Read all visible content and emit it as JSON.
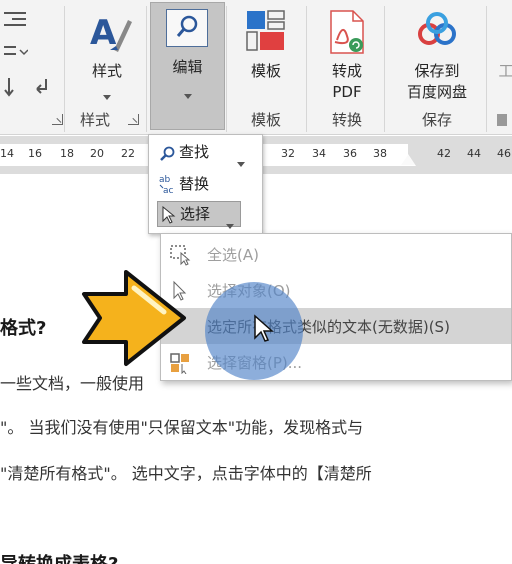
{
  "ribbon": {
    "buttons": {
      "style": "样式",
      "edit": "编辑",
      "template": "模板",
      "convert_pdf": [
        "转成",
        "PDF"
      ],
      "save_to_baidu": [
        "保存到",
        "百度网盘"
      ],
      "partial": "工"
    },
    "groups": {
      "style": "样式",
      "template": "模板",
      "convert": "转换",
      "save": "保存"
    }
  },
  "ruler": {
    "ticks": [
      "14",
      "16",
      "18",
      "20",
      "22",
      "32",
      "34",
      "36",
      "38",
      "42",
      "44",
      "46"
    ]
  },
  "edit_dropdown": {
    "find": "查找",
    "replace": "替换",
    "select": "选择"
  },
  "select_menu": {
    "items": [
      "全选(A)",
      "选择对象(O)",
      "选定所有格式类似的文本(无数据)(S)",
      "选择窗格(P)..."
    ]
  },
  "document": {
    "heading1": "格式?",
    "line1": "一些文档，一般使用",
    "line2": "\"。 当我们没有使用\"只保留文本\"功能，发现格式与",
    "line3": "\"清楚所有格式\"。 选中文字，点击字体中的【清楚所",
    "heading2": "导转换成表格?"
  },
  "colors": {
    "accent_blue": "#2b579a",
    "pdf_red": "#d9534f",
    "arrow_yellow": "#f5b21c",
    "highlight": "#5082c8"
  }
}
